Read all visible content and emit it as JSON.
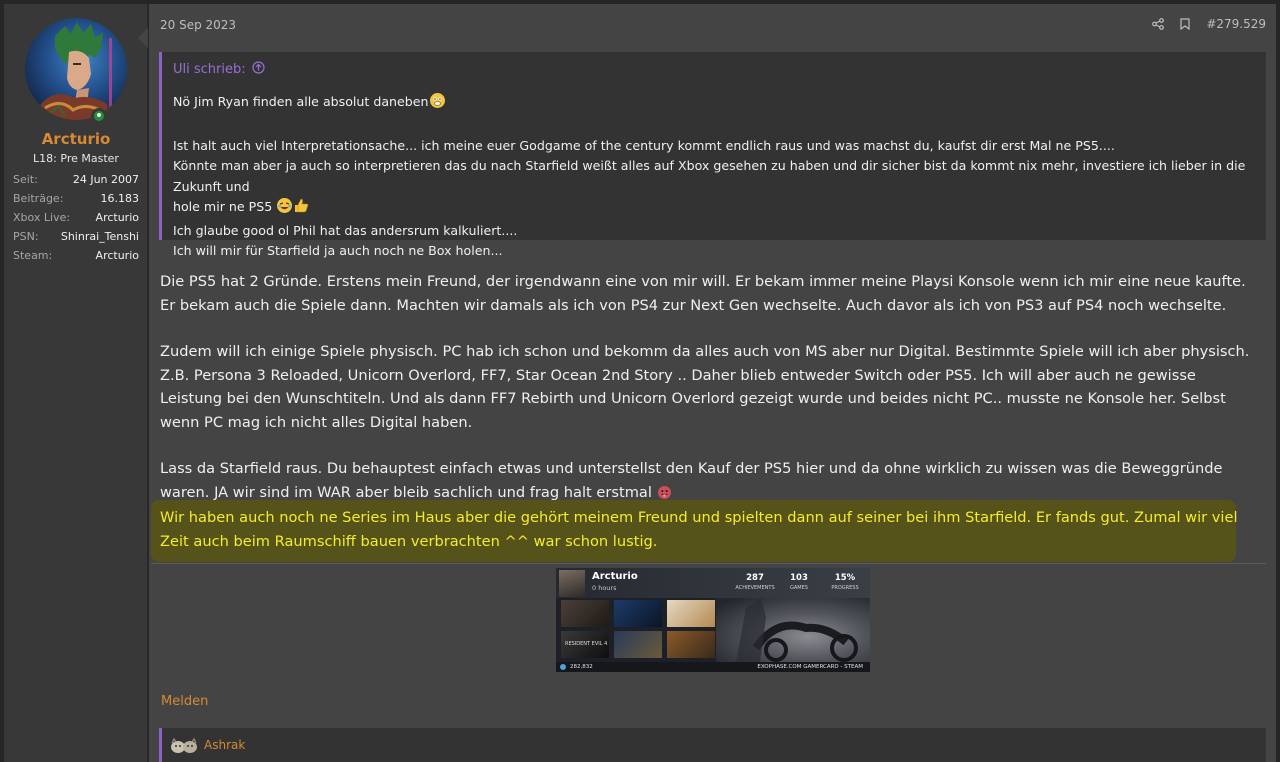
{
  "user": {
    "name": "Arcturio",
    "title": "L18: Pre Master",
    "stats": [
      {
        "label": "Seit:",
        "value": "24 Jun 2007"
      },
      {
        "label": "Beiträge:",
        "value": "16.183"
      },
      {
        "label": "Xbox Live:",
        "value": "Arcturio"
      },
      {
        "label": "PSN:",
        "value": "Shinrai_Tenshi"
      },
      {
        "label": "Steam:",
        "value": "Arcturio"
      }
    ],
    "online": true
  },
  "post": {
    "date": "20 Sep 2023",
    "number": "#279.529",
    "icons": [
      "share-icon",
      "bookmark-icon"
    ]
  },
  "quote": {
    "author": "Uli schrieb:",
    "lines": [
      "Nö Jim Ryan finden alle absolut daneben",
      "",
      "Ist halt auch viel Interpretationsache... ich meine euer Godgame of the century kommt endlich raus und was machst du, kaufst dir erst Mal ne PS5....",
      "Könnte man aber ja auch so interpretieren das du nach Starfield weißt alles auf Xbox gesehen zu haben und dir sicher bist da kommt nix mehr, investiere ich lieber in die Zukunft und",
      "hole mir ne PS5",
      "Ich glaube good ol Phil hat das andersrum kalkuliert....",
      "Ich will mir für Starfield ja auch noch ne Box holen..."
    ]
  },
  "body": {
    "p1": "Die PS5 hat 2 Gründe. Erstens mein Freund, der irgendwann eine von mir will. Er bekam immer meine Playsi Konsole wenn ich mir eine neue kaufte. Er bekam auch die Spiele dann. Machten wir damals als ich von PS4 zur Next Gen wechselte. Auch davor als ich von PS3 auf PS4 noch wechselte.",
    "p2": "Zudem will ich einige Spiele physisch. PC hab ich schon und bekomm da alles auch von MS aber nur Digital. Bestimmte Spiele will ich aber physisch. Z.B. Persona 3 Reloaded, Unicorn Overlord, FF7, Star Ocean 2nd Story .. Daher blieb entweder Switch oder PS5. Ich will aber auch ne gewisse Leistung bei den Wunschtiteln. Und als dann FF7 Rebirth und Unicorn Overlord gezeigt wurde und beides nicht PC.. musste ne Konsole her. Selbst wenn PC mag ich nicht alles Digital haben.",
    "p3": "Lass da Starfield raus. Du behauptest einfach etwas und unterstellst den Kauf der PS5 hier und da ohne wirklich zu wissen was die Beweggründe waren. JA wir sind im WAR aber bleib sachlich und frag halt erstmal",
    "highlight": "Wir haben auch noch ne Series im Haus aber die gehört meinem Freund und spielten dann auf seiner bei ihm Starfield. Er fands gut. Zumal wir viel Zeit auch beim Raumschiff bauen verbrachten ^^ war schon lustig.",
    "highlight_color": "#f6ec2e"
  },
  "gamercard": {
    "name": "Arcturio",
    "hours": "0 hours",
    "achievements": "287",
    "achievements_label": "ACHIEVEMENTS",
    "games": "103",
    "games_label": "GAMES",
    "progress": "15%",
    "progress_label": "PROGRESS",
    "points": "282,832",
    "footer": "EXOPHASE.COM GAMERCARD - STEAM",
    "game_tiles": [
      "RESIDENT EVIL 4"
    ]
  },
  "actions": {
    "report": "Melden"
  },
  "reactions": {
    "user": "Ashrak"
  },
  "colors": {
    "accent": "#d68a33",
    "quote_border": "#8b62c6"
  }
}
